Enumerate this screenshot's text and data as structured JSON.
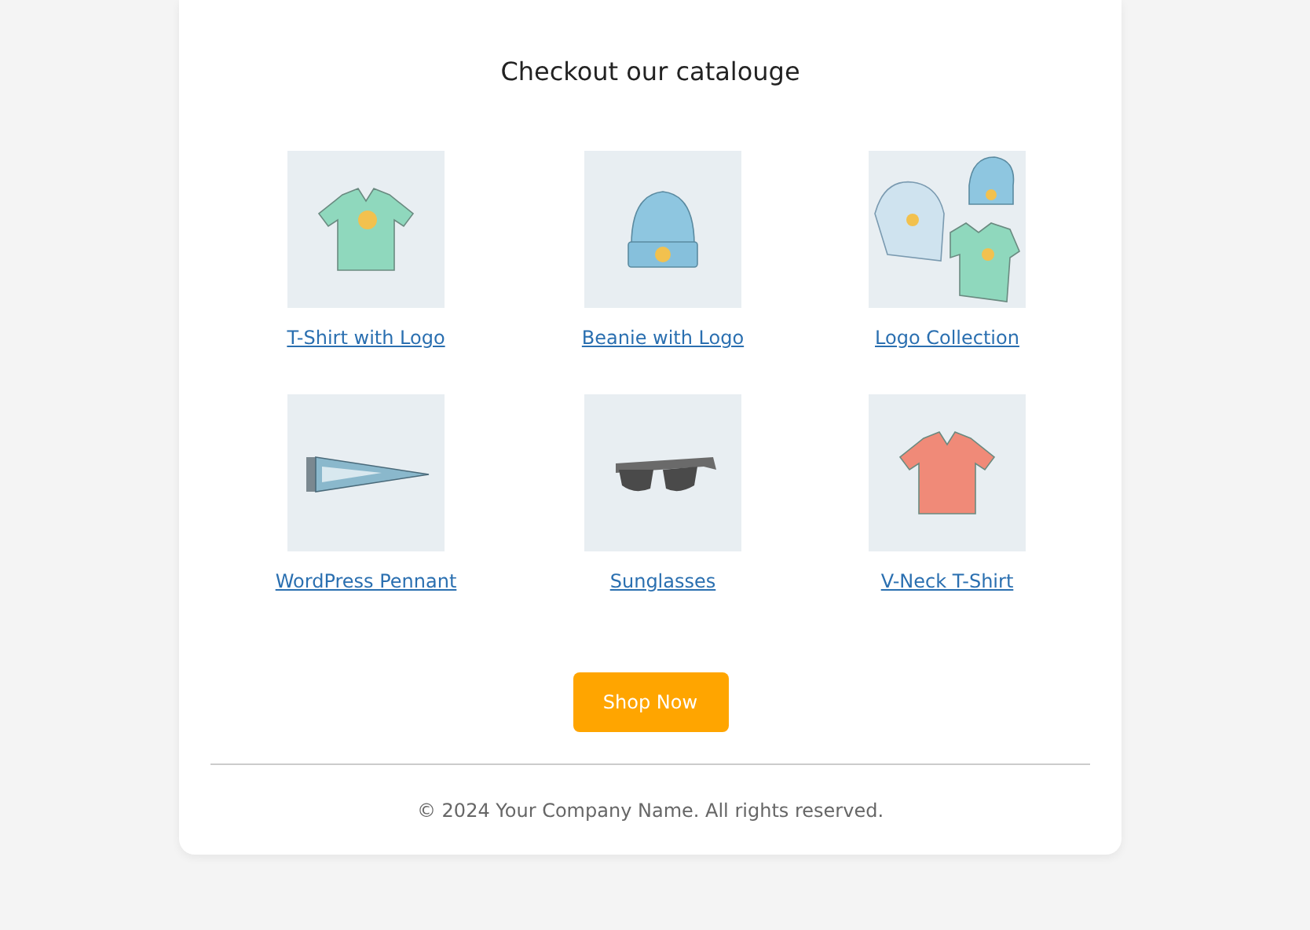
{
  "catalogue": {
    "title": "Checkout our catalouge",
    "products": [
      {
        "name": "T-Shirt with Logo"
      },
      {
        "name": "Beanie with Logo"
      },
      {
        "name": "Logo Collection"
      },
      {
        "name": "WordPress Pennant"
      },
      {
        "name": "Sunglasses"
      },
      {
        "name": "V-Neck T-Shirt"
      }
    ]
  },
  "button": "Shop Now",
  "footer": "© 2024 Your Company Name. All rights reserved."
}
